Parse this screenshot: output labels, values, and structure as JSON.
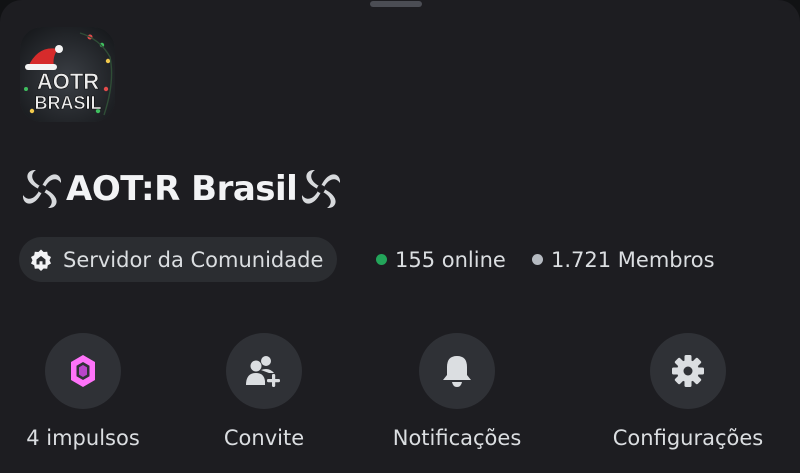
{
  "server": {
    "name": "AOT:R Brasil",
    "icon_text": [
      "AOTR",
      "BRASIL"
    ]
  },
  "badge": {
    "label": "Servidor da Comunidade",
    "icon": "community-server-icon"
  },
  "stats": {
    "online": "155 online",
    "members": "1.721 Membros"
  },
  "actions": [
    {
      "label": "4 impulsos",
      "icon": "boost-gem-icon"
    },
    {
      "label": "Convite",
      "icon": "invite-people-icon"
    },
    {
      "label": "Notificações",
      "icon": "bell-icon"
    },
    {
      "label": "Configurações",
      "icon": "gear-icon"
    }
  ],
  "colors": {
    "background": "#1d1d21",
    "pill": "#2b2d31",
    "button": "#2f3136",
    "online_dot": "#23a55a",
    "members_dot": "#b5bac1",
    "boost_pink": "#ff73fa",
    "text": "#dbdee1"
  }
}
